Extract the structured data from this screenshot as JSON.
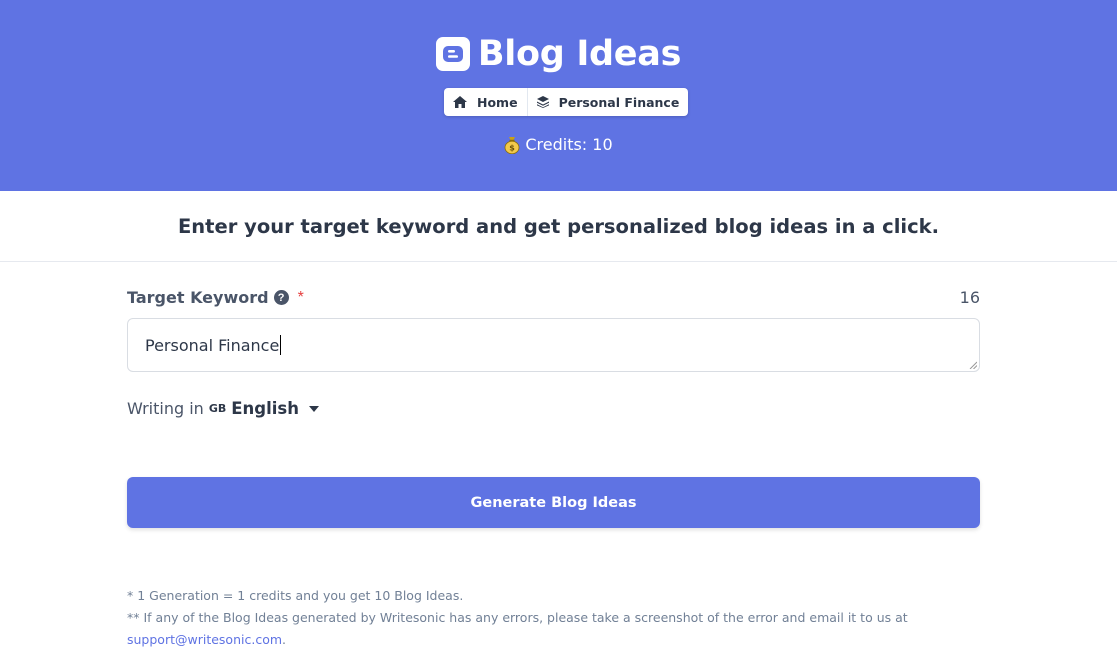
{
  "header": {
    "title": "Blog Ideas",
    "icon": "blogger-icon",
    "breadcrumb": [
      {
        "label": "Home",
        "icon": "home-icon"
      },
      {
        "label": "Personal Finance",
        "icon": "layers-icon"
      }
    ],
    "credits_label": "Credits: 10",
    "credits_icon": "money-bag-icon",
    "background_color": "#5f73e3"
  },
  "intro": {
    "subtitle": "Enter your target keyword and get personalized blog ideas in a click."
  },
  "form": {
    "keyword_label": "Target Keyword",
    "required_marker": "*",
    "char_count": "16",
    "keyword_value": "Personal Finance",
    "language_prefix": "Writing in",
    "language_flag": "GB",
    "language_value": "English",
    "generate_label": "Generate Blog Ideas"
  },
  "footer": {
    "note1": "* 1 Generation = 1 credits and you get 10 Blog Ideas.",
    "note2": "** If any of the Blog Ideas generated by Writesonic has any errors, please take a screenshot of the error and email it to us at",
    "email": "support@writesonic.com",
    "email_suffix": "."
  },
  "colors": {
    "accent": "#5f73e3",
    "required": "#e53e3e"
  }
}
